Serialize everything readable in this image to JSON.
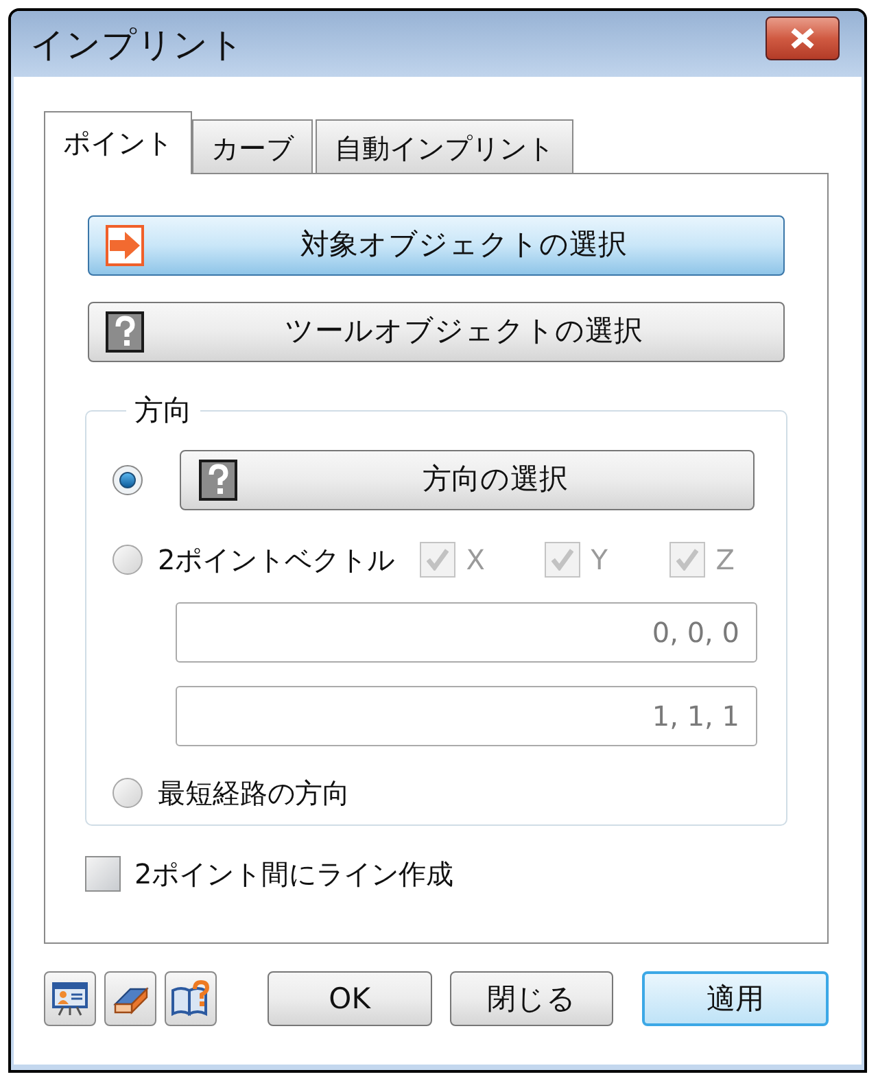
{
  "window": {
    "title": "インプリント"
  },
  "tabs": [
    {
      "label": "ポイント",
      "selected": true
    },
    {
      "label": "カーブ",
      "selected": false
    },
    {
      "label": "自動インプリント",
      "selected": false
    }
  ],
  "selection_buttons": [
    {
      "kind": "target",
      "label": "対象オブジェクトの選択",
      "active": true
    },
    {
      "kind": "unknown",
      "label": "ツールオブジェクトの選択",
      "active": false
    }
  ],
  "direction": {
    "title": "方向",
    "options": [
      {
        "kind": "button",
        "label": "方向の選択",
        "selected": true
      },
      {
        "kind": "vector",
        "label": "2ポイントベクトル",
        "selected": false,
        "axes": [
          {
            "label": "X",
            "checked": true,
            "disabled": true
          },
          {
            "label": "Y",
            "checked": true,
            "disabled": true
          },
          {
            "label": "Z",
            "checked": true,
            "disabled": true
          }
        ],
        "fields": [
          {
            "value": "0, 0, 0",
            "disabled": true
          },
          {
            "value": "1, 1, 1",
            "disabled": true
          }
        ]
      },
      {
        "kind": "plain",
        "label": "最短経路の方向",
        "selected": false
      }
    ]
  },
  "create_line": {
    "label": "2ポイント間にライン作成",
    "checked": false
  },
  "buttons": [
    {
      "label": "OK",
      "default": false
    },
    {
      "label": "閉じる",
      "default": false
    },
    {
      "label": "適用",
      "default": true
    }
  ]
}
